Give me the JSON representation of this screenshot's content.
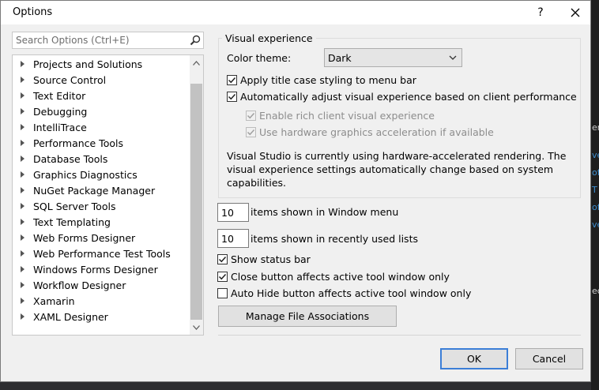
{
  "window": {
    "title": "Options",
    "help": "?"
  },
  "search": {
    "placeholder": "Search Options (Ctrl+E)"
  },
  "tree": {
    "items": [
      "Projects and Solutions",
      "Source Control",
      "Text Editor",
      "Debugging",
      "IntelliTrace",
      "Performance Tools",
      "Database Tools",
      "Graphics Diagnostics",
      "NuGet Package Manager",
      "SQL Server Tools",
      "Text Templating",
      "Web Forms Designer",
      "Web Performance Test Tools",
      "Windows Forms Designer",
      "Workflow Designer",
      "Xamarin",
      "XAML Designer"
    ]
  },
  "visual": {
    "group_title": "Visual experience",
    "color_theme_label": "Color theme:",
    "color_theme_value": "Dark",
    "title_case": "Apply title case styling to menu bar",
    "auto_adjust": "Automatically adjust visual experience based on client performance",
    "rich_client": "Enable rich client visual experience",
    "hw_accel": "Use hardware graphics acceleration if available",
    "info": "Visual Studio is currently using hardware-accelerated rendering. The visual experience settings automatically change based on system capabilities."
  },
  "general": {
    "window_menu_count": "10",
    "window_menu_label": "items shown in Window menu",
    "recent_count": "10",
    "recent_label": "items shown in recently used lists",
    "status_bar": "Show status bar",
    "close_button": "Close button affects active tool window only",
    "autohide_button": "Auto Hide button affects active tool window only",
    "manage_files": "Manage File Associations"
  },
  "footer": {
    "ok": "OK",
    "cancel": "Cancel"
  },
  "background": {
    "fragments": [
      "en",
      "ve",
      "of",
      "T",
      "of",
      "ve",
      "ec"
    ]
  },
  "colors": {
    "accent": "#3b7ed7",
    "dialog_bg": "#f0f0f0"
  }
}
